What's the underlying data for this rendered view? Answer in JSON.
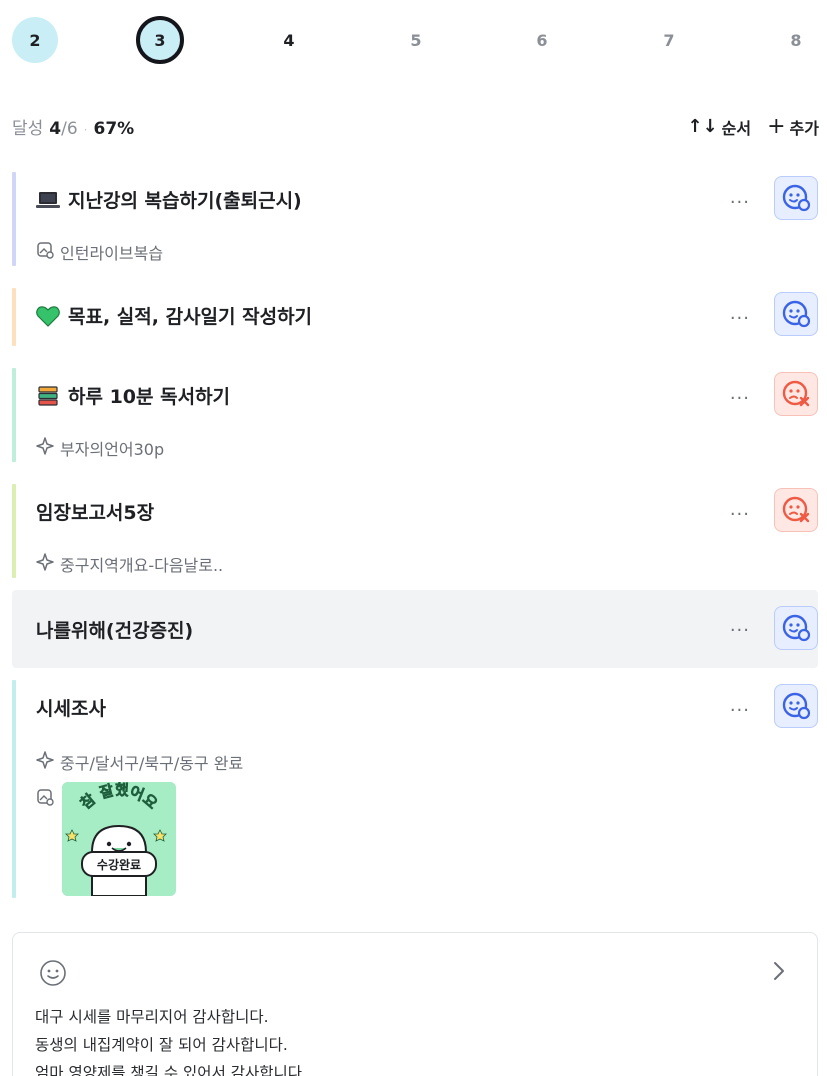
{
  "days": [
    {
      "label": "2",
      "state": "done"
    },
    {
      "label": "3",
      "state": "current"
    },
    {
      "label": "4",
      "state": "near"
    },
    {
      "label": "5",
      "state": "far"
    },
    {
      "label": "6",
      "state": "far"
    },
    {
      "label": "7",
      "state": "far"
    },
    {
      "label": "8",
      "state": "far"
    }
  ],
  "summary": {
    "prefix": "달성",
    "done": "4",
    "total": "/6",
    "percent": "67%"
  },
  "toolbar": {
    "order_icon": "↑↓",
    "order_label": "순서",
    "add_icon": "+",
    "add_label": "추가"
  },
  "tasks": [
    {
      "icon": "laptop-icon",
      "title": "지난강의 복습하기(출퇴근시)",
      "status": "success",
      "sub_icon": "image-icon",
      "sub": "인턴라이브복습",
      "bar_color": "#cfd6f7"
    },
    {
      "icon": "green-heart-icon",
      "title": "목표, 실적, 감사일기 작성하기",
      "status": "success",
      "bar_color": "#fde1bf"
    },
    {
      "icon": "books-icon",
      "title": "하루 10분 독서하기",
      "status": "fail",
      "sub_icon": "sparkle-icon",
      "sub": "부자의언어30p",
      "bar_color": "#bfeedd"
    },
    {
      "title": "임장보고서5장",
      "status": "fail",
      "sub_icon": "sparkle-icon",
      "sub": "중구지역개요-다음날로..",
      "bar_color": "#dcefb3"
    },
    {
      "title": "나를위해(건강증진)",
      "status": "success",
      "bar_color": "#f2f3f5"
    },
    {
      "title": "시세조사",
      "status": "success",
      "sub_icon": "sparkle-icon",
      "sub": "중구/달서구/북구/동구 완료",
      "photo_icon": "image-icon",
      "sticker_lines": [
        "참 잘했어요",
        "수강완료"
      ],
      "bar_color": "#c2efee"
    }
  ],
  "gratitude": {
    "lines": [
      "대구 시세를 마무리지어 감사합니다.",
      "동생의 내집계약이 잘 되어 감사합니다.",
      "엄마 영양제를 챙길 수 있어서 감사합니다."
    ]
  },
  "colors": {
    "success": "#3b63e6",
    "fail": "#ef5a45",
    "accent": "#c9eef6"
  }
}
